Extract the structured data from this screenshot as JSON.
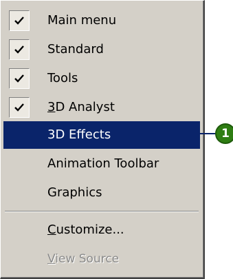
{
  "menu": {
    "items": [
      {
        "label": "Main menu",
        "checked": true
      },
      {
        "label": "Standard",
        "checked": true
      },
      {
        "label": "Tools",
        "checked": true
      },
      {
        "label_underline": "3",
        "label_rest": "D Analyst",
        "checked": true
      },
      {
        "label": "3D Effects",
        "checked": false,
        "highlighted": true
      },
      {
        "label": "Animation Toolbar",
        "checked": false
      },
      {
        "label": "Graphics",
        "checked": false
      }
    ],
    "customize": {
      "underline": "C",
      "rest": "ustomize..."
    },
    "view_source": {
      "underline": "V",
      "rest": "iew Source",
      "disabled": true
    }
  },
  "callout": {
    "number": "1",
    "color": "#2e7d12"
  },
  "colors": {
    "highlight": "#0a246a",
    "menu_bg": "#d4d0c8"
  },
  "icons": {
    "check": "checkmark-icon"
  }
}
